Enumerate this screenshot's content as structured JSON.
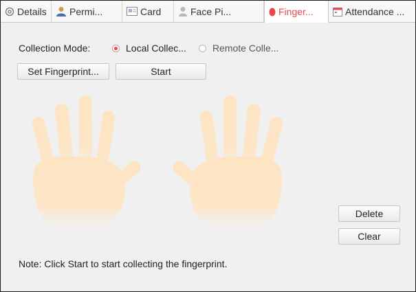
{
  "tabs": [
    {
      "label": "Details",
      "icon": "gear-icon"
    },
    {
      "label": "Permi...",
      "icon": "person-icon"
    },
    {
      "label": "Card",
      "icon": "card-icon"
    },
    {
      "label": "Face Pi...",
      "icon": "face-icon"
    },
    {
      "label": "Finger...",
      "icon": "fingerprint-icon",
      "active": true
    },
    {
      "label": "Attendance ...",
      "icon": "calendar-icon"
    }
  ],
  "collection": {
    "label": "Collection Mode:",
    "local_label": "Local Collec...",
    "remote_label": "Remote Colle...",
    "selected": "local"
  },
  "buttons": {
    "set_fingerprint": "Set Fingerprint...",
    "start": "Start",
    "delete": "Delete",
    "clear": "Clear"
  },
  "note": "Note: Click Start to start collecting the fingerprint.",
  "colors": {
    "accent": "#e8474c",
    "hand": "#fde3c2"
  }
}
